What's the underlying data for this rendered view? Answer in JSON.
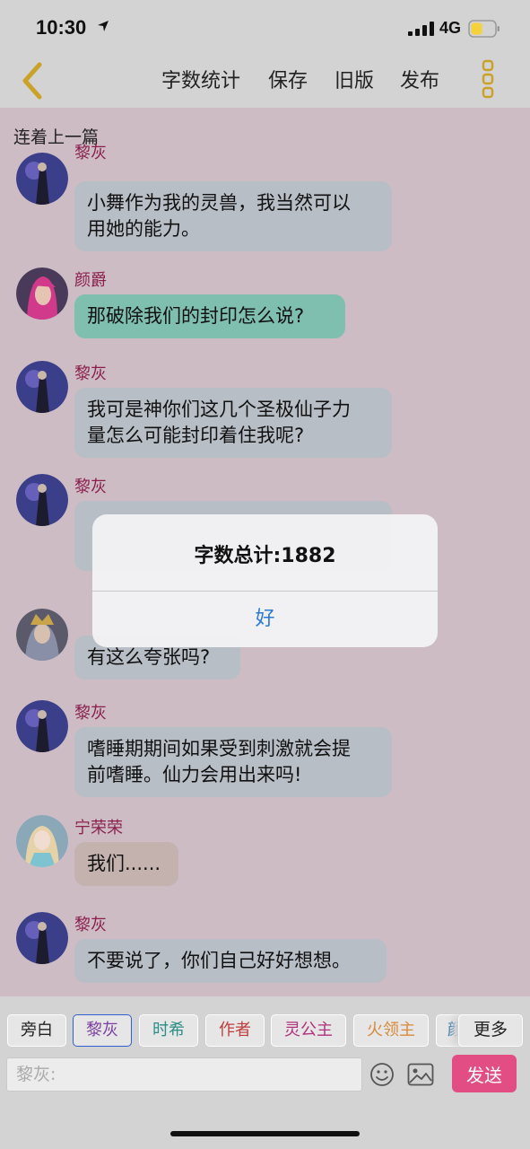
{
  "status_bar": {
    "time": "10:30",
    "network": "4G",
    "battery_color": "#f3d23a"
  },
  "nav": {
    "word_count": "字数统计",
    "save": "保存",
    "old_version": "旧版",
    "publish": "发布",
    "accent_color": "#c9a227"
  },
  "chat": {
    "prev_link": "连着上一篇",
    "messages": [
      {
        "sender": "黎灰",
        "text_lines": [
          "小舞作为我的灵兽，我当然可以",
          "用她的能力。"
        ],
        "bubble": "gray",
        "avatar": "lihui"
      },
      {
        "sender": "颜爵",
        "text_lines": [
          "那破除我们的封印怎么说?"
        ],
        "bubble": "teal",
        "avatar": "yanjue"
      },
      {
        "sender": "黎灰",
        "text_lines": [
          "我可是神你们这几个圣极仙子力",
          "量怎么可能封印着住我呢?"
        ],
        "bubble": "gray",
        "avatar": "lihui"
      },
      {
        "sender": "黎灰",
        "text_lines": [
          "",
          ""
        ],
        "bubble": "gray",
        "avatar": "lihui"
      },
      {
        "sender": "",
        "text_lines": [
          "有这么夸张吗?"
        ],
        "bubble": "gray",
        "avatar": "pang"
      },
      {
        "sender": "黎灰",
        "text_lines": [
          "嗜睡期期间如果受到刺激就会提",
          "前嗜睡。仙力会用出来吗!"
        ],
        "bubble": "gray",
        "avatar": "lihui"
      },
      {
        "sender": "宁荣荣",
        "text_lines": [
          "我们......"
        ],
        "bubble": "beige",
        "avatar": "ningrongrong"
      },
      {
        "sender": "黎灰",
        "text_lines": [
          "不要说了，你们自己好好想想。"
        ],
        "bubble": "gray",
        "avatar": "lihui"
      }
    ]
  },
  "toolbar": {
    "roles": [
      {
        "label": "旁白",
        "color": "#222222"
      },
      {
        "label": "黎灰",
        "color": "#7a3fa0",
        "selected": true
      },
      {
        "label": "时希",
        "color": "#2a8f86"
      },
      {
        "label": "作者",
        "color": "#c23b3b"
      },
      {
        "label": "灵公主",
        "color": "#b0307a"
      },
      {
        "label": "火领主",
        "color": "#d9893a"
      },
      {
        "label": "颜",
        "color": "#2a6f9e"
      }
    ],
    "more": "更多",
    "input_placeholder": "黎灰:",
    "send": "发送"
  },
  "alert": {
    "message": "字数总计:1882",
    "ok": "好"
  }
}
